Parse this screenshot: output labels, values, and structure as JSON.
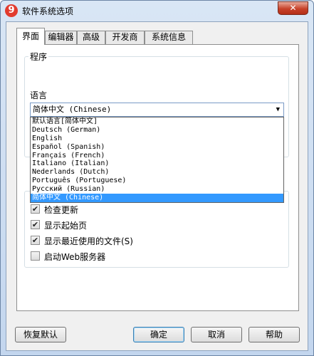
{
  "window": {
    "title": "软件系统选项",
    "app_icon": "9",
    "close_glyph": "✕"
  },
  "tabs": [
    {
      "label": "界面",
      "active": true
    },
    {
      "label": "编辑器",
      "active": false
    },
    {
      "label": "高级",
      "active": false
    },
    {
      "label": "开发商",
      "active": false
    },
    {
      "label": "系统信息",
      "active": false
    }
  ],
  "program_group": {
    "label": "程序"
  },
  "language": {
    "label": "语言",
    "selected": "简体中文 (Chinese)",
    "options": [
      "默认语言[简体中文]",
      "Deutsch (German)",
      "English",
      "Español (Spanish)",
      "Français (French)",
      "Italiano (Italian)",
      "Nederlands (Dutch)",
      "Português (Portuguese)",
      "Русский (Russian)",
      "简体中文 (Chinese)"
    ],
    "selected_index": 9
  },
  "checkboxes": [
    {
      "label": "检查更新",
      "checked": true
    },
    {
      "label": "显示起始页",
      "checked": true
    },
    {
      "label": "显示最近使用的文件(S)",
      "checked": true
    },
    {
      "label": "启动Web服务器",
      "checked": false
    }
  ],
  "buttons": {
    "restore_default": "恢复默认",
    "ok": "确定",
    "cancel": "取消",
    "help": "帮助"
  },
  "colors": {
    "selection": "#3399ff",
    "close_button": "#c7422a",
    "app_icon": "#e23b2e"
  }
}
